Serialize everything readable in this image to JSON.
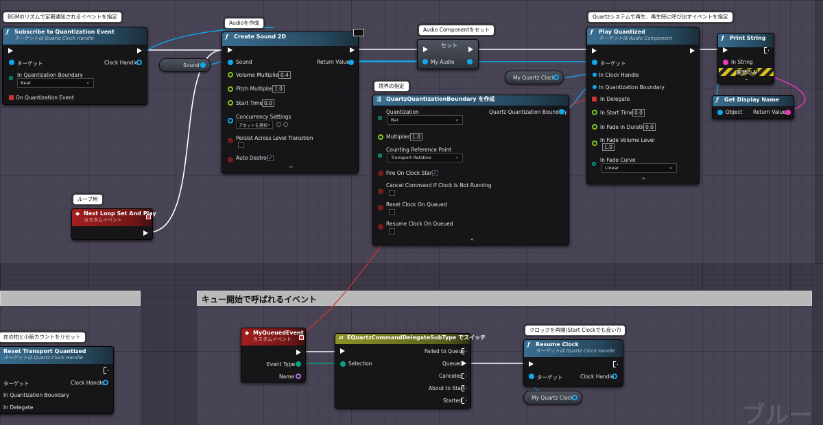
{
  "comments": {
    "top_region": "",
    "left_region": "",
    "queue_region": "キュー開始で呼ばれるイベント"
  },
  "bubbles": {
    "subscribe": "BGMのリズムで定期通知されるイベントを指定",
    "audio_create": "Audioを作成",
    "audio_set": "Audio Componentをセット",
    "quartz_play": "Quartzシステムで再生、再生時に呼び出すイベントを指定",
    "loop": "ループ用",
    "boundary": "境界の指定",
    "reset": "在の拍と小節カウントをリセット",
    "resume": "クロックを再開(Start Clockでも良い?)"
  },
  "nodes": {
    "subscribe": {
      "title": "Subscribe to Quantization Event",
      "subtitle": "ターゲットは Quartz Clock Handle",
      "target": "ターゲット",
      "clock_handle": "Clock Handle",
      "boundary": "In Quantization Boundary",
      "boundary_value": "Beat",
      "on_event": "On Quantization Event"
    },
    "sound_var": "Sound",
    "create_sound": {
      "title": "Create Sound 2D",
      "sound": "Sound",
      "return_value": "Return Value",
      "volume": "Volume Multiplier",
      "volume_value": "0.4",
      "pitch": "Pitch Multiplier",
      "pitch_value": "1.0",
      "start_time": "Start Time",
      "start_time_value": "0.0",
      "concurrency": "Concurrency Settings",
      "concurrency_value": "アセットを選択",
      "persist": "Persist Across Level Transition",
      "auto_destroy": "Auto Destroy"
    },
    "set_audio": {
      "title": "セット",
      "var": "My Audio"
    },
    "my_quartz_clock_1": "My Quartz Clock",
    "play_quantized": {
      "title": "Play Quantized",
      "subtitle": "ターゲットは Audio Component",
      "target": "ターゲット",
      "clock_handle": "In Clock Handle",
      "boundary": "In Quantization Boundary",
      "delegate": "In Delegate",
      "start_time": "In Start Time",
      "start_time_value": "0.0",
      "fade_duration": "In Fade in Duration",
      "fade_duration_value": "0.0",
      "fade_volume": "In Fade Volume Level",
      "fade_volume_value": "1.0",
      "fade_curve": "In Fade Curve",
      "fade_curve_value": "Linear"
    },
    "print_string": {
      "title": "Print String",
      "in_string": "In String",
      "dev_only": "開発のみ"
    },
    "get_display_name": {
      "title": "Get Display Name",
      "object": "Object",
      "return_value": "Return Value"
    },
    "make_boundary": {
      "title": "QuartzQuantizationBoundary を作成",
      "output": "Quartz Quantization Boundary",
      "quantization": "Quantization",
      "quantization_value": "Bar",
      "multiplier": "Multiplier",
      "multiplier_value": "1.0",
      "counting": "Counting Reference Point",
      "counting_value": "Transport Relative",
      "fire_on_start": "Fire On Clock Start",
      "cancel_if_not_running": "Cancel Command If Clock Is Not Running",
      "reset_on_queued": "Reset Clock On Queued",
      "resume_on_queued": "Resume Clock On Queued"
    },
    "next_loop": {
      "title": "Next Loop Set And Play",
      "subtitle": "カスタムイベント"
    },
    "reset_transport": {
      "title": "Reset Transport Quantized",
      "subtitle": "ターゲットは Quartz Clock Handle",
      "target": "ターゲット",
      "clock_handle": "Clock Handle",
      "boundary": "In Quantization Boundary",
      "delegate": "In Delegate"
    },
    "my_queued": {
      "title": "MyQueuedEvent",
      "subtitle": "カスタムイベント",
      "event_type": "Event Type",
      "name": "Name"
    },
    "switch": {
      "title": "EQuartzCommandDelegateSubType でスイッチ",
      "selection": "Selection",
      "failed": "Failed to Queue",
      "queued": "Queued",
      "canceled": "Canceled",
      "about_to_start": "About to Start",
      "started": "Started"
    },
    "resume_clock": {
      "title": "Resume Clock",
      "subtitle": "ターゲットは Quartz Clock Handle",
      "target": "ターゲット",
      "clock_handle": "Clock Handle"
    },
    "my_quartz_clock_2": "My Quartz Clock"
  },
  "watermark": "ブルー",
  "colors": {
    "exec_wire": "#ffffff",
    "object_wire": "#10a8f0",
    "delegate_wire": "#d23434",
    "string_wire": "#f136c0",
    "enum_wire": "#0a9f84"
  }
}
